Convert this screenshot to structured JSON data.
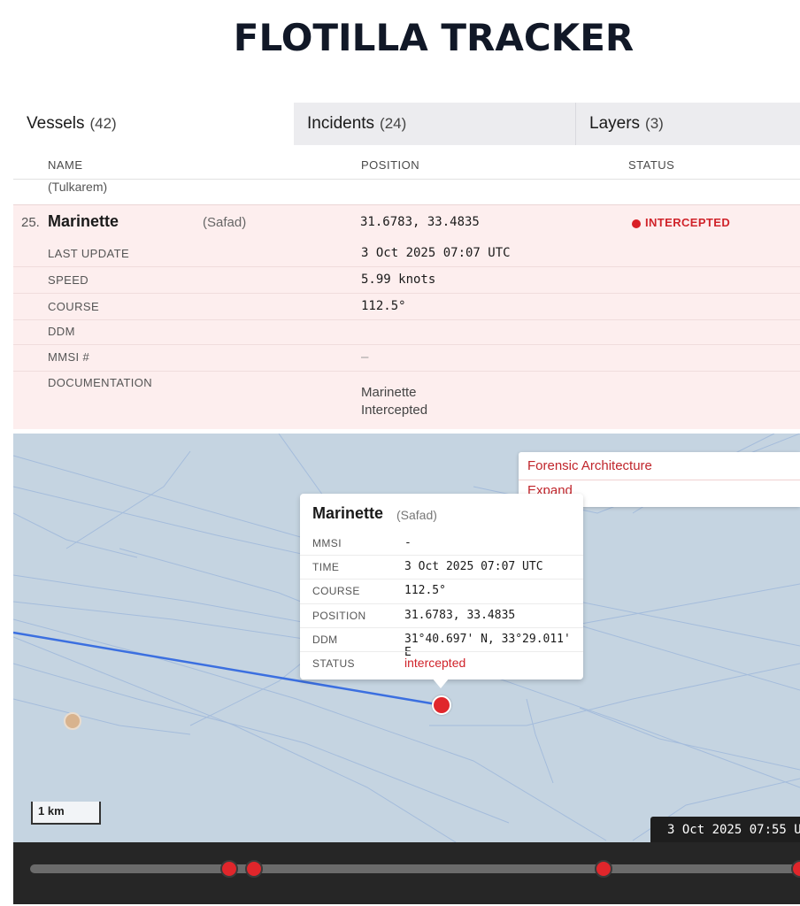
{
  "app": {
    "title": "FLOTILLA TRACKER"
  },
  "tabs": [
    {
      "label": "Vessels",
      "count": "(42)"
    },
    {
      "label": "Incidents",
      "count": "(24)"
    },
    {
      "label": "Layers",
      "count": "(3)"
    }
  ],
  "table": {
    "columns": {
      "name": "NAME",
      "position": "POSITION",
      "status": "STATUS"
    },
    "previous_row_origin": "(Tulkarem)"
  },
  "selected_vessel": {
    "index": "25.",
    "name": "Marinette",
    "origin": "(Safad)",
    "position": "31.6783, 33.4835",
    "status": "INTERCEPTED",
    "status_color": "#d91f26",
    "details": [
      {
        "label": "LAST UPDATE",
        "value": "3 Oct 2025 07:07 UTC"
      },
      {
        "label": "SPEED",
        "value": "5.99 knots"
      },
      {
        "label": "COURSE",
        "value": "112.5°"
      },
      {
        "label": "DDM",
        "value": ""
      },
      {
        "label": "MMSI #",
        "value": "–"
      },
      {
        "label": "DOCUMENTATION",
        "value": ""
      }
    ],
    "documentation": [
      "Marinette",
      "Intercepted"
    ]
  },
  "map": {
    "attribution": {
      "link": "Forensic Architecture",
      "expand": "Expand"
    },
    "popup": {
      "name": "Marinette",
      "origin": "(Safad)",
      "rows": [
        {
          "label": "MMSI",
          "value": "-"
        },
        {
          "label": "TIME",
          "value": "3 Oct 2025 07:07 UTC"
        },
        {
          "label": "COURSE",
          "value": "112.5°"
        },
        {
          "label": "POSITION",
          "value": "31.6783, 33.4835"
        },
        {
          "label": "DDM",
          "value": "31°40.697' N, 33°29.011' E"
        },
        {
          "label": "STATUS",
          "value": "intercepted"
        }
      ]
    },
    "scale": "1 km",
    "time_readout": "3 Oct 2025 07:55 U",
    "colors": {
      "water": "#c5d4e1",
      "track": "#3b6fe0",
      "marker": "#e0262b",
      "other_vessel": "#d8b38e"
    }
  },
  "timeline": {
    "event_count": 4
  }
}
